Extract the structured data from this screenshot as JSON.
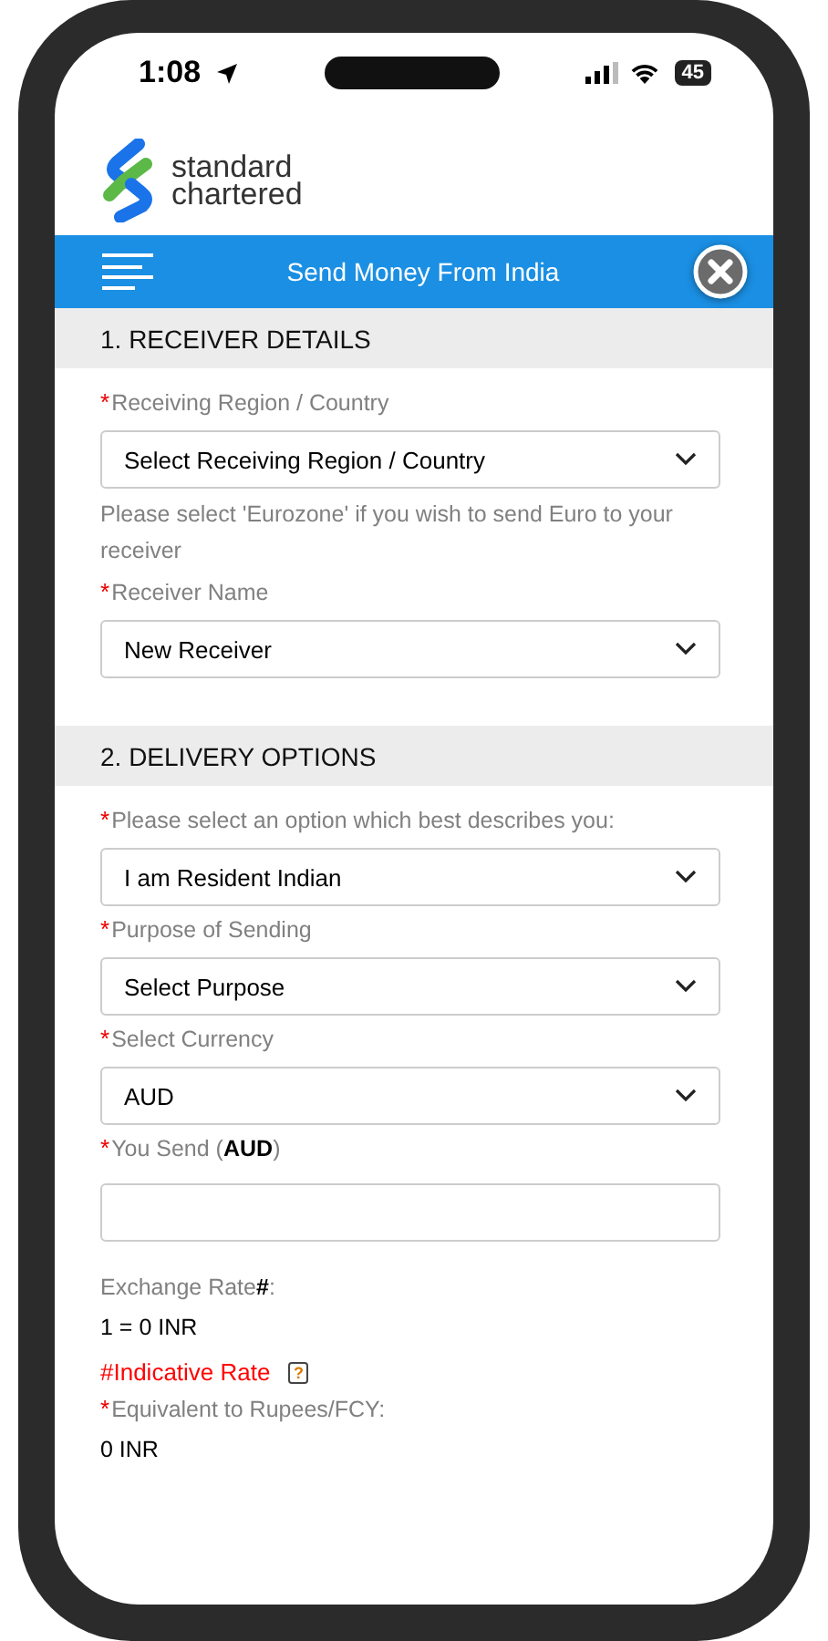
{
  "status_bar": {
    "time": "1:08",
    "battery": "45"
  },
  "logo": {
    "line_1": "standard",
    "line_2": "chartered"
  },
  "nav_bar": {
    "title": "Send Money From India"
  },
  "sections": [
    {
      "title": "1. RECEIVER DETAILS",
      "items": [
        {
          "kind": "select",
          "mark": "*",
          "label": "Receiving Region / Country",
          "value": "Select Receiving Region / Country"
        },
        {
          "kind": "hint",
          "text": "Please select 'Eurozone' if you wish to send Euro to your receiver"
        },
        {
          "kind": "select",
          "mark": "*",
          "label": "Receiver Name",
          "value": "New Receiver"
        }
      ]
    },
    {
      "title": "2. DELIVERY OPTIONS",
      "items": [
        {
          "kind": "select",
          "mark": "*",
          "label": "Please select an option which best describes you:",
          "value": "I am Resident Indian"
        },
        {
          "kind": "select",
          "mark": "*",
          "label": "Purpose of Sending",
          "value": "Select Purpose"
        },
        {
          "kind": "select",
          "mark": "*",
          "label": "Select Currency",
          "value": "AUD"
        },
        {
          "kind": "input",
          "mark": "*",
          "label": "You Send (**AUD**)"
        },
        {
          "kind": "output",
          "label": "Exchange Rate**#**:",
          "value": "1 = 0 INR"
        },
        {
          "kind": "note",
          "text": "#Indicative Rate",
          "help": "?"
        },
        {
          "kind": "output",
          "mark": "*",
          "label": "Equivalent to Rupees/FCY:",
          "value": "0 INR"
        }
      ]
    }
  ]
}
